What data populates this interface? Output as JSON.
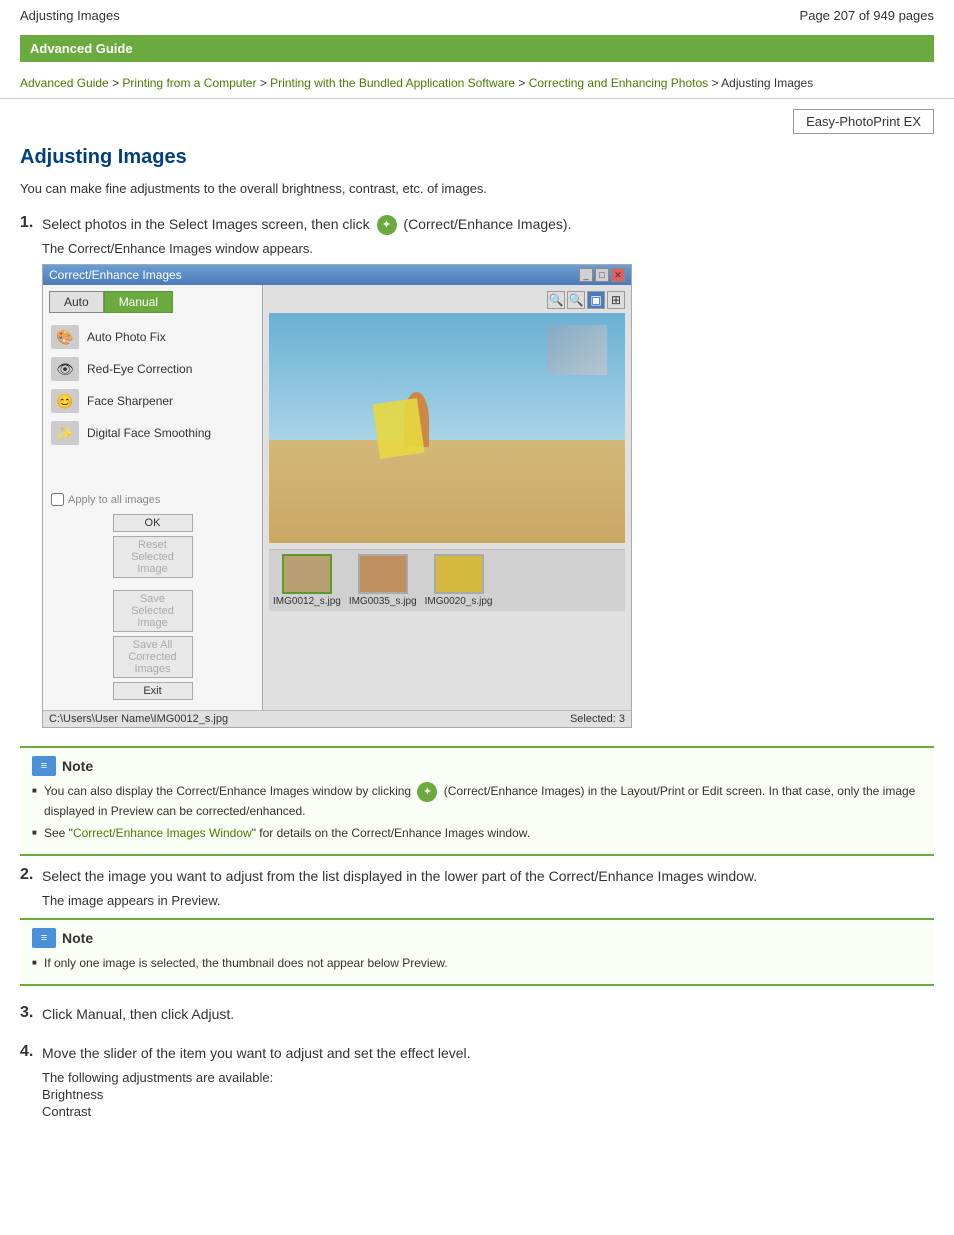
{
  "header": {
    "title": "Adjusting Images",
    "pagination": "Page 207 of 949 pages"
  },
  "banner": {
    "text": "Advanced Guide"
  },
  "breadcrumb": {
    "items": [
      {
        "label": "Advanced Guide",
        "link": true
      },
      {
        "label": " > ",
        "link": false
      },
      {
        "label": "Printing from a Computer",
        "link": true
      },
      {
        "label": " > ",
        "link": false
      },
      {
        "label": "Printing with the Bundled Application Software",
        "link": true
      },
      {
        "label": " > ",
        "link": false
      },
      {
        "label": "Correcting and Enhancing Photos",
        "link": true
      },
      {
        "label": " > ",
        "link": false
      },
      {
        "label": "Adjusting Images",
        "link": false
      }
    ]
  },
  "product_badge": "Easy-PhotoPrint EX",
  "page_title": "Adjusting Images",
  "intro": "You can make fine adjustments to the overall brightness, contrast, etc. of images.",
  "steps": [
    {
      "number": "1.",
      "text_before": "Select photos in the Select Images screen, then click",
      "text_after": "(Correct/Enhance Images).",
      "subtext": "The Correct/Enhance Images window appears."
    },
    {
      "number": "2.",
      "text": "Select the image you want to adjust from the list displayed in the lower part of the Correct/Enhance Images window.",
      "subtext": "The image appears in Preview."
    },
    {
      "number": "3.",
      "text": "Click Manual, then click Adjust."
    },
    {
      "number": "4.",
      "text": "Move the slider of the item you want to adjust and set the effect level.",
      "subtext": "The following adjustments are available:",
      "adjustments": [
        "Brightness",
        "Contrast"
      ]
    }
  ],
  "dialog": {
    "title": "Correct/Enhance Images",
    "tabs": [
      {
        "label": "Auto",
        "active": false
      },
      {
        "label": "Manual",
        "active": true
      }
    ],
    "tools": [
      {
        "icon": "🎨",
        "label": "Auto Photo Fix"
      },
      {
        "icon": "👁",
        "label": "Red-Eye Correction"
      },
      {
        "icon": "😊",
        "label": "Face Sharpener"
      },
      {
        "icon": "✨",
        "label": "Digital Face Smoothing"
      }
    ],
    "buttons": [
      {
        "label": "OK",
        "disabled": false
      },
      {
        "label": "Reset Selected Image",
        "disabled": true
      },
      {
        "label": "Save Selected Image",
        "disabled": true
      },
      {
        "label": "Save All Corrected Images",
        "disabled": true
      },
      {
        "label": "Exit",
        "disabled": false
      }
    ],
    "checkbox_label": "Apply to all images",
    "statusbar_left": "C:\\Users\\User Name\\IMG0012_s.jpg",
    "statusbar_right": "Selected: 3",
    "thumbnails": [
      {
        "label": "IMG0012_s.jpg",
        "selected": true
      },
      {
        "label": "IMG0035_s.jpg",
        "selected": false
      },
      {
        "label": "IMG0020_s.jpg",
        "selected": false
      }
    ]
  },
  "notes": [
    {
      "items": [
        "You can also display the Correct/Enhance Images window by clicking  (Correct/Enhance Images) in the Layout/Print or Edit screen. In that case, only the image displayed in Preview can be corrected/enhanced.",
        "See \"Correct/Enhance Images Window\" for details on the Correct/Enhance Images window."
      ]
    },
    {
      "items": [
        "If only one image is selected, the thumbnail does not appear below Preview."
      ]
    }
  ],
  "note_link1": "Correct/Enhance Images Window",
  "note_label": "Note"
}
